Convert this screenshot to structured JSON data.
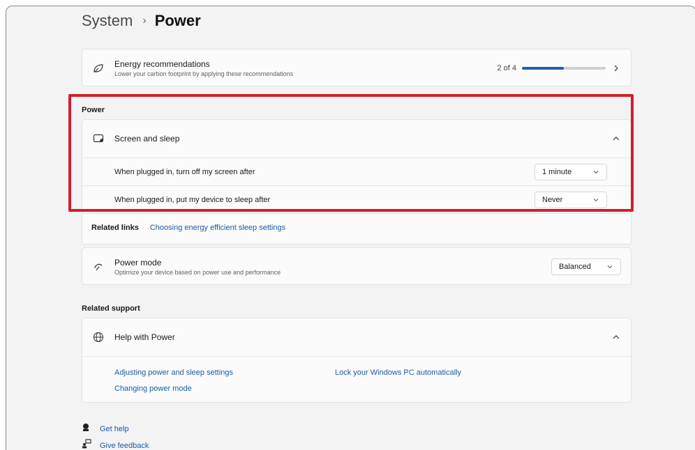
{
  "breadcrumb": {
    "parent": "System",
    "separator": "›",
    "current": "Power"
  },
  "energy": {
    "title": "Energy recommendations",
    "subtitle": "Lower your carbon footprint by applying these recommendations",
    "progress_text": "2 of 4",
    "progress_fraction": 0.5,
    "icon": "leaf-icon"
  },
  "power_section": {
    "label": "Power",
    "screen_sleep": {
      "title": "Screen and sleep",
      "icon": "screen-sleep-icon",
      "rows": [
        {
          "label": "When plugged in, turn off my screen after",
          "value": "1 minute"
        },
        {
          "label": "When plugged in, put my device to sleep after",
          "value": "Never"
        }
      ]
    }
  },
  "related_links": {
    "label": "Related links",
    "link": "Choosing energy efficient sleep settings"
  },
  "power_mode": {
    "title": "Power mode",
    "subtitle": "Optimize your device based on power use and performance",
    "value": "Balanced",
    "icon": "power-mode-icon"
  },
  "related_support": {
    "label": "Related support",
    "help": {
      "title": "Help with Power",
      "icon": "globe-icon",
      "links": [
        "Adjusting power and sleep settings",
        "Changing power mode",
        "Lock your Windows PC automatically"
      ]
    }
  },
  "footer": {
    "get_help": "Get help",
    "give_feedback": "Give feedback"
  },
  "colors": {
    "accent": "#1f5fae",
    "highlight": "#cf1f2e",
    "link": "#1a5ba6"
  }
}
